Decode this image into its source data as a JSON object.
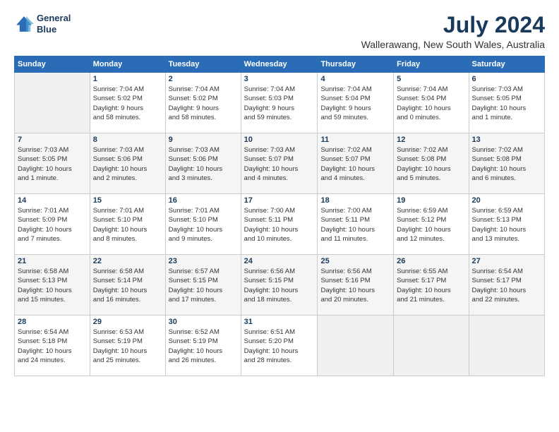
{
  "header": {
    "logo_line1": "General",
    "logo_line2": "Blue",
    "title": "July 2024",
    "subtitle": "Wallerawang, New South Wales, Australia"
  },
  "weekdays": [
    "Sunday",
    "Monday",
    "Tuesday",
    "Wednesday",
    "Thursday",
    "Friday",
    "Saturday"
  ],
  "weeks": [
    [
      {
        "day": "",
        "info": ""
      },
      {
        "day": "1",
        "info": "Sunrise: 7:04 AM\nSunset: 5:02 PM\nDaylight: 9 hours\nand 58 minutes."
      },
      {
        "day": "2",
        "info": "Sunrise: 7:04 AM\nSunset: 5:02 PM\nDaylight: 9 hours\nand 58 minutes."
      },
      {
        "day": "3",
        "info": "Sunrise: 7:04 AM\nSunset: 5:03 PM\nDaylight: 9 hours\nand 59 minutes."
      },
      {
        "day": "4",
        "info": "Sunrise: 7:04 AM\nSunset: 5:04 PM\nDaylight: 9 hours\nand 59 minutes."
      },
      {
        "day": "5",
        "info": "Sunrise: 7:04 AM\nSunset: 5:04 PM\nDaylight: 10 hours\nand 0 minutes."
      },
      {
        "day": "6",
        "info": "Sunrise: 7:03 AM\nSunset: 5:05 PM\nDaylight: 10 hours\nand 1 minute."
      }
    ],
    [
      {
        "day": "7",
        "info": "Sunrise: 7:03 AM\nSunset: 5:05 PM\nDaylight: 10 hours\nand 1 minute."
      },
      {
        "day": "8",
        "info": "Sunrise: 7:03 AM\nSunset: 5:06 PM\nDaylight: 10 hours\nand 2 minutes."
      },
      {
        "day": "9",
        "info": "Sunrise: 7:03 AM\nSunset: 5:06 PM\nDaylight: 10 hours\nand 3 minutes."
      },
      {
        "day": "10",
        "info": "Sunrise: 7:03 AM\nSunset: 5:07 PM\nDaylight: 10 hours\nand 4 minutes."
      },
      {
        "day": "11",
        "info": "Sunrise: 7:02 AM\nSunset: 5:07 PM\nDaylight: 10 hours\nand 4 minutes."
      },
      {
        "day": "12",
        "info": "Sunrise: 7:02 AM\nSunset: 5:08 PM\nDaylight: 10 hours\nand 5 minutes."
      },
      {
        "day": "13",
        "info": "Sunrise: 7:02 AM\nSunset: 5:08 PM\nDaylight: 10 hours\nand 6 minutes."
      }
    ],
    [
      {
        "day": "14",
        "info": "Sunrise: 7:01 AM\nSunset: 5:09 PM\nDaylight: 10 hours\nand 7 minutes."
      },
      {
        "day": "15",
        "info": "Sunrise: 7:01 AM\nSunset: 5:10 PM\nDaylight: 10 hours\nand 8 minutes."
      },
      {
        "day": "16",
        "info": "Sunrise: 7:01 AM\nSunset: 5:10 PM\nDaylight: 10 hours\nand 9 minutes."
      },
      {
        "day": "17",
        "info": "Sunrise: 7:00 AM\nSunset: 5:11 PM\nDaylight: 10 hours\nand 10 minutes."
      },
      {
        "day": "18",
        "info": "Sunrise: 7:00 AM\nSunset: 5:11 PM\nDaylight: 10 hours\nand 11 minutes."
      },
      {
        "day": "19",
        "info": "Sunrise: 6:59 AM\nSunset: 5:12 PM\nDaylight: 10 hours\nand 12 minutes."
      },
      {
        "day": "20",
        "info": "Sunrise: 6:59 AM\nSunset: 5:13 PM\nDaylight: 10 hours\nand 13 minutes."
      }
    ],
    [
      {
        "day": "21",
        "info": "Sunrise: 6:58 AM\nSunset: 5:13 PM\nDaylight: 10 hours\nand 15 minutes."
      },
      {
        "day": "22",
        "info": "Sunrise: 6:58 AM\nSunset: 5:14 PM\nDaylight: 10 hours\nand 16 minutes."
      },
      {
        "day": "23",
        "info": "Sunrise: 6:57 AM\nSunset: 5:15 PM\nDaylight: 10 hours\nand 17 minutes."
      },
      {
        "day": "24",
        "info": "Sunrise: 6:56 AM\nSunset: 5:15 PM\nDaylight: 10 hours\nand 18 minutes."
      },
      {
        "day": "25",
        "info": "Sunrise: 6:56 AM\nSunset: 5:16 PM\nDaylight: 10 hours\nand 20 minutes."
      },
      {
        "day": "26",
        "info": "Sunrise: 6:55 AM\nSunset: 5:17 PM\nDaylight: 10 hours\nand 21 minutes."
      },
      {
        "day": "27",
        "info": "Sunrise: 6:54 AM\nSunset: 5:17 PM\nDaylight: 10 hours\nand 22 minutes."
      }
    ],
    [
      {
        "day": "28",
        "info": "Sunrise: 6:54 AM\nSunset: 5:18 PM\nDaylight: 10 hours\nand 24 minutes."
      },
      {
        "day": "29",
        "info": "Sunrise: 6:53 AM\nSunset: 5:19 PM\nDaylight: 10 hours\nand 25 minutes."
      },
      {
        "day": "30",
        "info": "Sunrise: 6:52 AM\nSunset: 5:19 PM\nDaylight: 10 hours\nand 26 minutes."
      },
      {
        "day": "31",
        "info": "Sunrise: 6:51 AM\nSunset: 5:20 PM\nDaylight: 10 hours\nand 28 minutes."
      },
      {
        "day": "",
        "info": ""
      },
      {
        "day": "",
        "info": ""
      },
      {
        "day": "",
        "info": ""
      }
    ]
  ]
}
